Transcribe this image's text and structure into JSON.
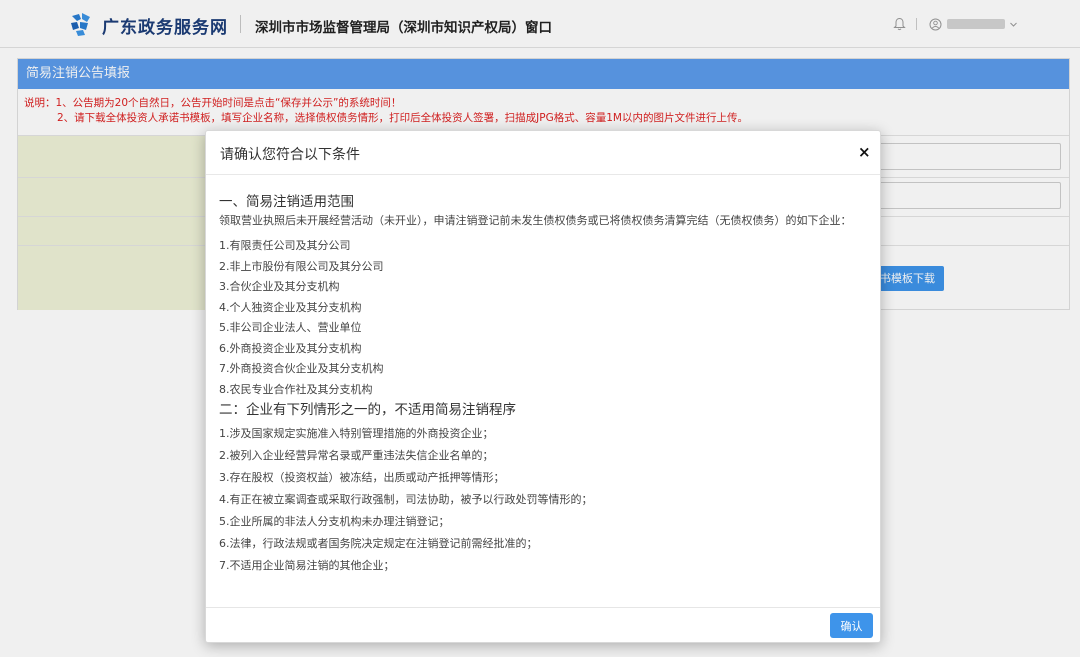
{
  "header": {
    "brand": "广东政务服务网",
    "office": "深圳市市场监督管理局（深圳市知识产权局）窗口",
    "icons": {
      "logo": "gd-logo-icon",
      "bell": "bell-icon",
      "user": "user-icon",
      "chevron": "chevron-down-icon"
    }
  },
  "form": {
    "title": "简易注销公告填报",
    "notice_line1": "说明：1、公告期为20个自然日，公告开始时间是点击“保存并公示”的系统时间！",
    "notice_line2": "2、请下载全体投资人承诺书模板，填写企业名称，选择债权债务情形，打印后全体投资人签署，扫描成JPG格式、容量1M以内的图片文件进行上传。",
    "download_label": "书模板下载"
  },
  "modal": {
    "title": "请确认您符合以下条件",
    "close_symbol": "×",
    "section1": {
      "title": "一、简易注销适用范围",
      "intro": "领取营业执照后未开展经营活动（未开业），申请注销登记前未发生债权债务或已将债权债务清算完结（无债权债务）的如下企业：",
      "items": [
        "1.有限责任公司及其分公司",
        "2.非上市股份有限公司及其分公司",
        "3.合伙企业及其分支机构",
        "4.个人独资企业及其分支机构",
        "5.非公司企业法人、营业单位",
        "6.外商投资企业及其分支机构",
        "7.外商投资合伙企业及其分支机构",
        "8.农民专业合作社及其分支机构"
      ]
    },
    "section2": {
      "title": "二：企业有下列情形之一的，不适用简易注销程序",
      "items": [
        "1.涉及国家规定实施准入特别管理措施的外商投资企业；",
        "2.被列入企业经营异常名录或严重违法失信企业名单的；",
        "3.存在股权（投资权益）被冻结，出质或动产抵押等情形；",
        "4.有正在被立案调查或采取行政强制，司法协助，被予以行政处罚等情形的；",
        "5.企业所属的非法人分支机构未办理注销登记；",
        "6.法律，行政法规或者国务院决定规定在注销登记前需经批准的；",
        "7.不适用企业简易注销的其他企业；"
      ]
    },
    "confirm_label": "确认"
  },
  "colors": {
    "brand": "#1d3e7a",
    "title_bar": "#5c9ceb",
    "button": "#3e94ea",
    "notice": "#dd2222",
    "label_column": "#eef2d7"
  }
}
